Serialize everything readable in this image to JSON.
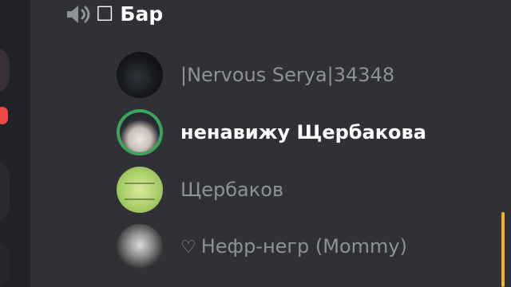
{
  "channel": {
    "icon": "speaker-icon",
    "prefix": "☐",
    "name": "Бар"
  },
  "members": [
    {
      "name": "|Nervous Serya|34348",
      "state": "muted",
      "avatar": "dark-creature"
    },
    {
      "name": "ненавижу Щербакова",
      "state": "speaking",
      "avatar": "anime-boy"
    },
    {
      "name": "Щербаков",
      "state": "muted",
      "avatar": "green-paper"
    },
    {
      "name": "Нефр-негр (Mommy)",
      "state": "muted",
      "prefix": "♡",
      "avatar": "grey-figure"
    }
  ],
  "colors": {
    "background": "#2f3136",
    "guild_bar": "#202225",
    "speaking_ring": "#3ba55c",
    "muted_text": "#8e9297",
    "active_text": "#ffffff",
    "scrollbar_accent": "#f0b232",
    "unread_indicator": "#f04747"
  }
}
